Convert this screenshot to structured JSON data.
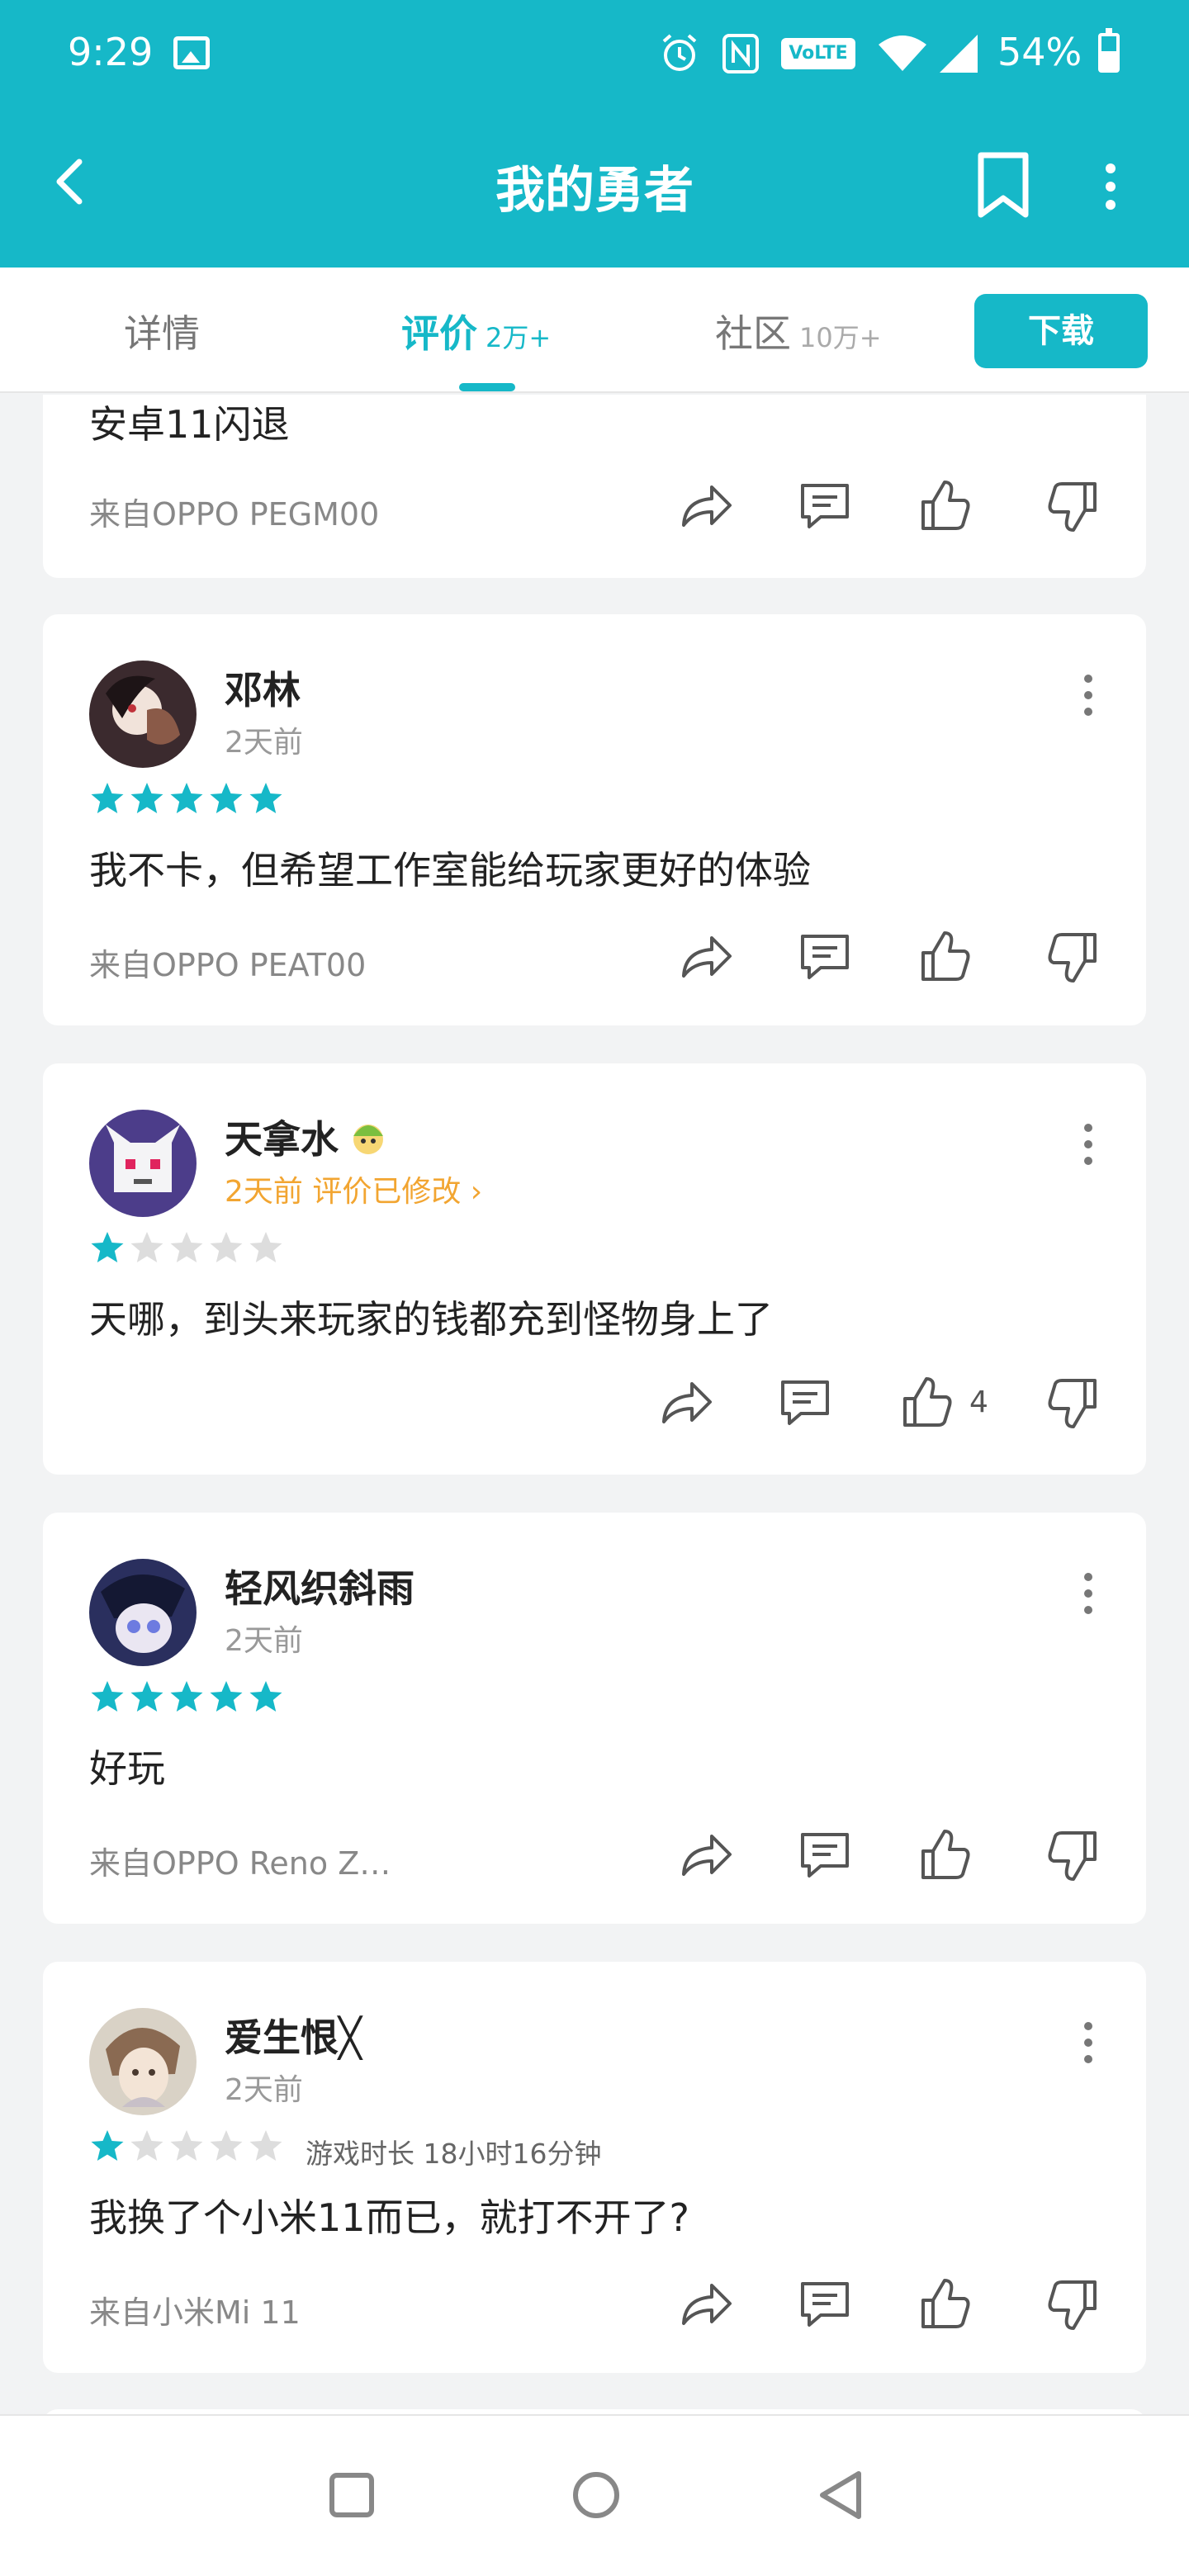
{
  "status_bar": {
    "time": "9:29",
    "battery": "54%",
    "volte": "VoLTE"
  },
  "app_bar": {
    "title": "我的勇者"
  },
  "tabs": [
    {
      "label": "详情",
      "count": ""
    },
    {
      "label": "评价",
      "count": "2万+"
    },
    {
      "label": "社区",
      "count": "10万+"
    }
  ],
  "download_label": "下载",
  "partial_review": {
    "text": "安卓11闪退",
    "device": "来自OPPO PEGM00"
  },
  "reviews": [
    {
      "name": "邓林",
      "time": "2天前",
      "rating": 5,
      "text": "我不卡，但希望工作室能给玩家更好的体验",
      "device": "来自OPPO PEAT00",
      "likes": ""
    },
    {
      "name": "天拿水",
      "time": "2天前 评价已修改 ›",
      "rating": 1,
      "text": "天哪，到头来玩家的钱都充到怪物身上了",
      "device": "",
      "likes": "4"
    },
    {
      "name": "轻风织斜雨",
      "time": "2天前",
      "rating": 5,
      "text": "好玩",
      "device": "来自OPPO Reno Z…",
      "likes": ""
    },
    {
      "name": "爱生恨╳",
      "time": "2天前",
      "rating": 1,
      "playtime": "游戏时长 18小时16分钟",
      "text": "我换了个小米11而已，就打不开了?",
      "device": "来自小米Mi 11",
      "likes": ""
    }
  ],
  "colors": {
    "accent": "#16b8c8",
    "edited": "#f2a531",
    "star_off": "#dddddd"
  }
}
